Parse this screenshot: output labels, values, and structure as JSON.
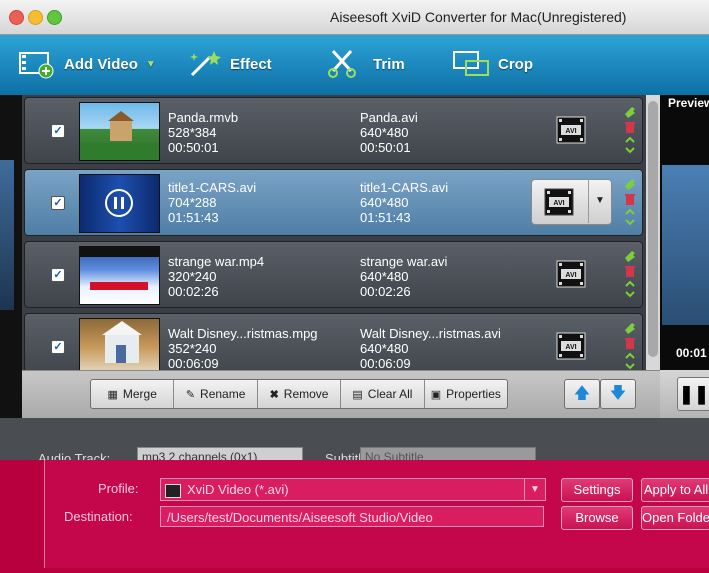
{
  "window": {
    "title": "Aiseesoft XviD Converter for Mac(Unregistered)"
  },
  "toolbar": {
    "add_video": "Add Video",
    "effect": "Effect",
    "trim": "Trim",
    "crop": "Crop"
  },
  "files": [
    {
      "source_name": "Panda.rmvb",
      "source_res": "528*384",
      "source_dur": "00:50:01",
      "out_name": "Panda.avi",
      "out_res": "640*480",
      "out_dur": "00:50:01",
      "checked": true
    },
    {
      "source_name": "title1-CARS.avi",
      "source_res": "704*288",
      "source_dur": "01:51:43",
      "out_name": "title1-CARS.avi",
      "out_res": "640*480",
      "out_dur": "01:51:43",
      "checked": true
    },
    {
      "source_name": "strange war.mp4",
      "source_res": "320*240",
      "source_dur": "00:02:26",
      "out_name": "strange war.avi",
      "out_res": "640*480",
      "out_dur": "00:02:26",
      "checked": true
    },
    {
      "source_name": "Walt Disney...ristmas.mpg",
      "source_res": "352*240",
      "source_dur": "00:06:09",
      "out_name": "Walt Disney...ristmas.avi",
      "out_res": "640*480",
      "out_dur": "00:06:09",
      "checked": true
    }
  ],
  "format_badge": "AVI",
  "list_buttons": {
    "merge": "Merge",
    "rename": "Rename",
    "remove": "Remove",
    "clear_all": "Clear All",
    "properties": "Properties"
  },
  "preview": {
    "title": "Preview",
    "time": "00:01"
  },
  "audio": {
    "audio_track_label": "Audio Track:",
    "audio_track_value": "mp3 2 channels (0x1)",
    "subtitle_label": "Subtitle:",
    "subtitle_value": "No Subtitle"
  },
  "output": {
    "profile_label": "Profile:",
    "profile_value": "XviD Video (*.avi)",
    "settings_button": "Settings",
    "apply_button": "Apply to All",
    "destination_label": "Destination:",
    "destination_value": "/Users/test/Documents/Aiseesoft Studio/Video",
    "browse_button": "Browse",
    "open_folder_button": "Open Folder"
  },
  "colors": {
    "toolbar": "#1a86c0",
    "highlight": "#c4064a",
    "selected_row": "#6f99bd"
  }
}
